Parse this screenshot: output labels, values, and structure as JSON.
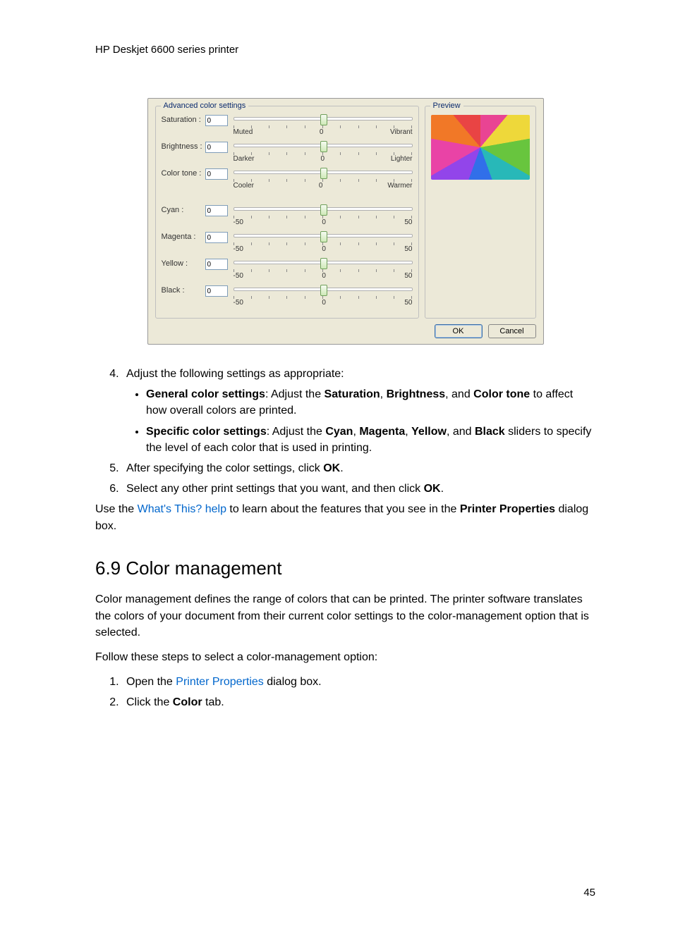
{
  "header": "HP Deskjet 6600 series printer",
  "dialog": {
    "advanced_legend": "Advanced color settings",
    "preview_legend": "Preview",
    "ok": "OK",
    "cancel": "Cancel",
    "sliders1": [
      {
        "label": "Saturation :",
        "value": "0",
        "min": "Muted",
        "mid": "0",
        "max": "Vibrant"
      },
      {
        "label": "Brightness :",
        "value": "0",
        "min": "Darker",
        "mid": "0",
        "max": "Lighter"
      },
      {
        "label": "Color tone :",
        "value": "0",
        "min": "Cooler",
        "mid": "0",
        "max": "Warmer"
      }
    ],
    "sliders2": [
      {
        "label": "Cyan :",
        "value": "0",
        "min": "-50",
        "mid": "0",
        "max": "50"
      },
      {
        "label": "Magenta :",
        "value": "0",
        "min": "-50",
        "mid": "0",
        "max": "50"
      },
      {
        "label": "Yellow :",
        "value": "0",
        "min": "-50",
        "mid": "0",
        "max": "50"
      },
      {
        "label": "Black :",
        "value": "0",
        "min": "-50",
        "mid": "0",
        "max": "50"
      }
    ]
  },
  "steps": {
    "s4": "Adjust the following settings as appropriate:",
    "b1_bold": "General color settings",
    "b1_rest1": ": Adjust the ",
    "b1_sat": "Saturation",
    "b1_c1": ", ",
    "b1_bri": "Brightness",
    "b1_c2": ", and ",
    "b1_ct": "Color tone",
    "b1_end": " to affect how overall colors are printed.",
    "b2_bold": "Specific color settings",
    "b2_rest1": ": Adjust the ",
    "b2_cy": "Cyan",
    "b2_c1": ", ",
    "b2_mg": "Magenta",
    "b2_c2": ", ",
    "b2_ye": "Yellow",
    "b2_c3": ", and ",
    "b2_bk": "Black",
    "b2_end": " sliders to specify the level of each color that is used in printing.",
    "s5_a": "After specifying the color settings, click ",
    "s5_ok": "OK",
    "s5_b": ".",
    "s6_a": "Select any other print settings that you want, and then click ",
    "s6_ok": "OK",
    "s6_b": "."
  },
  "usepara": {
    "a": "Use the ",
    "link": "What's This? help",
    "b": " to learn about the features that you see in the ",
    "pp": "Printer Properties",
    "c": " dialog box."
  },
  "section_title": "6.9  Color management",
  "cm_para": "Color management defines the range of colors that can be printed. The printer software translates the colors of your document from their current color settings to the color-management option that is selected.",
  "cm_follow": "Follow these steps to select a color-management option:",
  "cm1_a": "Open the ",
  "cm1_link": "Printer Properties",
  "cm1_b": " dialog box.",
  "cm2_a": "Click the ",
  "cm2_color": "Color",
  "cm2_b": " tab.",
  "page_number": "45"
}
